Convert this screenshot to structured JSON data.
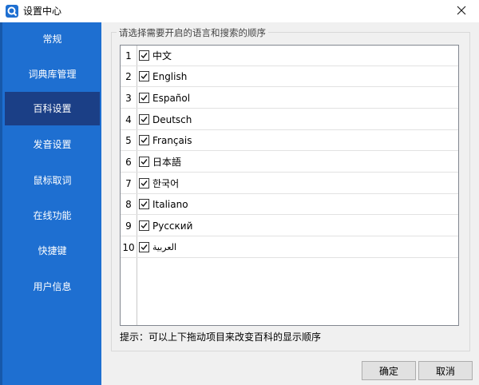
{
  "window": {
    "title": "设置中心",
    "app_icon": "dict-app-icon",
    "close_icon": "close-icon"
  },
  "sidebar": {
    "items": [
      {
        "label": "常规",
        "active": false
      },
      {
        "label": "词典库管理",
        "active": false
      },
      {
        "label": "百科设置",
        "active": true
      },
      {
        "label": "发音设置",
        "active": false
      },
      {
        "label": "鼠标取词",
        "active": false
      },
      {
        "label": "在线功能",
        "active": false
      },
      {
        "label": "快捷键",
        "active": false
      },
      {
        "label": "用户信息",
        "active": false
      }
    ],
    "colors": {
      "background": "#1e6fd1",
      "active": "#1b3f86"
    }
  },
  "main": {
    "group_title": "请选择需要开启的语言和搜索的顺序",
    "languages": [
      {
        "num": "1",
        "label": "中文",
        "checked": true
      },
      {
        "num": "2",
        "label": "English",
        "checked": true
      },
      {
        "num": "3",
        "label": "Español",
        "checked": true
      },
      {
        "num": "4",
        "label": "Deutsch",
        "checked": true
      },
      {
        "num": "5",
        "label": "Français",
        "checked": true
      },
      {
        "num": "6",
        "label": "日本語",
        "checked": true
      },
      {
        "num": "7",
        "label": "한국어",
        "checked": true
      },
      {
        "num": "8",
        "label": "Italiano",
        "checked": true
      },
      {
        "num": "9",
        "label": "Русский",
        "checked": true
      },
      {
        "num": "10",
        "label": "العربية",
        "checked": true
      }
    ],
    "hint": "提示：可以上下拖动项目来改变百科的显示顺序"
  },
  "footer": {
    "ok_label": "确定",
    "cancel_label": "取消"
  }
}
